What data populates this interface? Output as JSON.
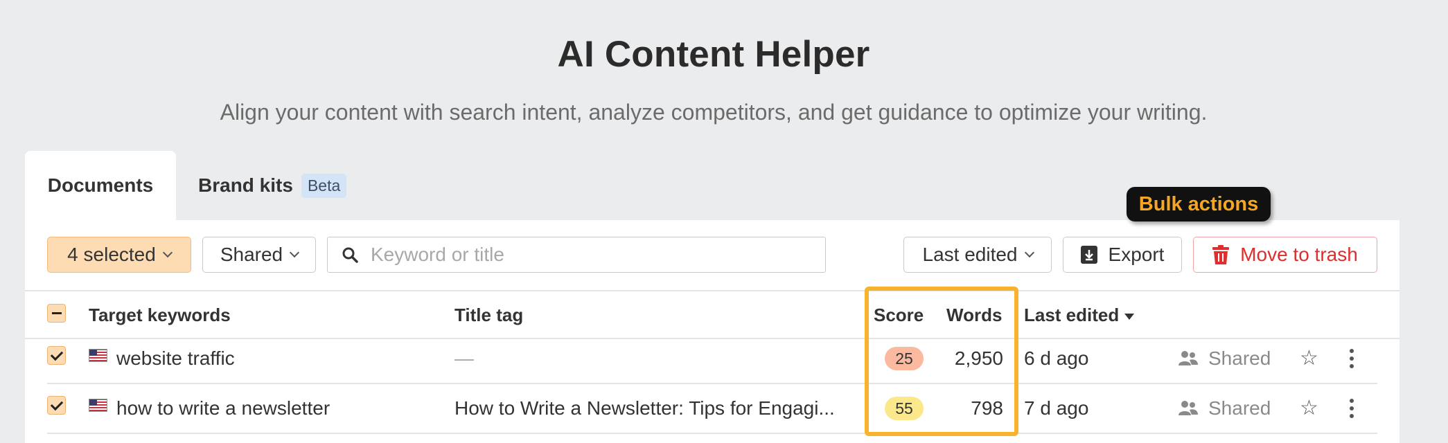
{
  "header": {
    "title": "AI Content Helper",
    "subtitle": "Align your content with search intent, analyze competitors, and get guidance to optimize your writing."
  },
  "tabs": [
    {
      "label": "Documents",
      "active": true
    },
    {
      "label": "Brand kits",
      "badge": "Beta",
      "active": false
    }
  ],
  "toolbar": {
    "selected_label": "4 selected",
    "shared_filter_label": "Shared",
    "search_placeholder": "Keyword or title",
    "search_value": "",
    "sort_label": "Last edited",
    "export_label": "Export",
    "trash_label": "Move to trash"
  },
  "tooltip": {
    "text": "Bulk actions"
  },
  "table": {
    "columns": {
      "keywords": "Target keywords",
      "title": "Title tag",
      "score": "Score",
      "words": "Words",
      "last_edited": "Last edited"
    },
    "rows": [
      {
        "checked": true,
        "flag": "us-flag",
        "keyword": "website traffic",
        "title": "—",
        "score": "25",
        "score_color": "#fbb9a0",
        "words": "2,950",
        "last_edited": "6 d ago",
        "sharing": "Shared"
      },
      {
        "checked": true,
        "flag": "us-flag",
        "keyword": "how to write a newsletter",
        "title": "How to Write a Newsletter: Tips for Engagi...",
        "score": "55",
        "score_color": "#fbe88a",
        "words": "798",
        "last_edited": "7 d ago",
        "sharing": "Shared"
      }
    ]
  },
  "colors": {
    "accent_orange": "#f7b32b",
    "selected_bg": "#fddcb4",
    "danger": "#e02d2d"
  }
}
